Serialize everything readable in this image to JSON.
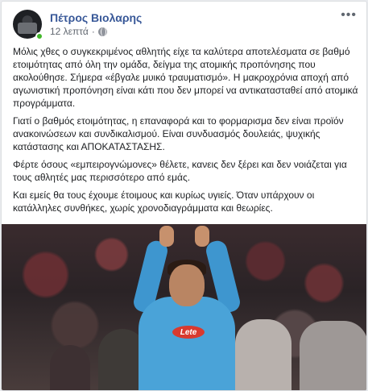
{
  "post": {
    "author": "Πέτρος Βιολαρης",
    "time": "12 λεπτά",
    "separator": "·",
    "more_icon": "more-options-icon",
    "paragraphs": [
      "Μόλις χθες ο συγκεκριμένος αθλητής είχε τα καλύτερα αποτελέσματα σε βαθμό ετοιμότητας από όλη την ομάδα, δείγμα της ατομικής προπόνησης που ακολούθησε. Σήμερα «έβγαλε μυικό τραυματισμό». Η μακροχρόνια αποχή από αγωνιστική προπόνηση είναι κάτι που δεν μπορεί να αντικατασταθεί από ατομικά προγράμματα.",
      "Γιατί ο βαθμός ετοιμότητας, η επαναφορά και το φορμαρισμα δεν είναι προϊόν ανακοινώσεων και συνδικαλισμού. Είναι συνδυασμός δουλειάς, ψυχικής κατάστασης και ΑΠΟΚΑΤΑΣΤΑΣΗΣ.",
      "Φέρτε όσους «εμπειρογνώμονες» θέλετε, κανεις δεν ξέρει και δεν νοιάζεται για τους αθλητές μας περισσότερο από εμάς.",
      "Και εμείς θα τους έχουμε έτοιμους και κυρίως υγιείς. Όταν υπάρχουν οι κατάλληλες συνθήκες, χωρίς χρονοδιαγράμματα και θεωρίες."
    ],
    "photo": {
      "sponsor_text": "Lete"
    }
  }
}
